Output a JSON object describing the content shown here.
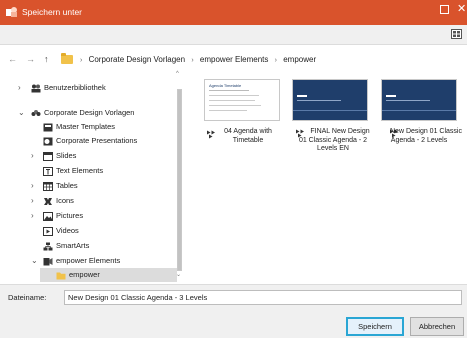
{
  "window": {
    "title": "Speichern unter",
    "title_bar_color": "#d9532c"
  },
  "nav": {
    "breadcrumbs": [
      "Corporate Design Vorlagen",
      "empower Elements",
      "empower"
    ]
  },
  "tree": {
    "items": [
      {
        "label": "Benutzerbibliothek",
        "icon": "library-icon",
        "expander": "collapsed"
      },
      {
        "label": "Corporate Design Vorlagen",
        "icon": "corporate-library-icon",
        "expander": "expanded"
      },
      {
        "label": "Master Templates",
        "icon": "master-templates-icon",
        "expander": "none"
      },
      {
        "label": "Corporate Presentations",
        "icon": "presentation-icon",
        "expander": "none"
      },
      {
        "label": "Slides",
        "icon": "slides-icon",
        "expander": "collapsed"
      },
      {
        "label": "Text Elements",
        "icon": "text-elements-icon",
        "expander": "none"
      },
      {
        "label": "Tables",
        "icon": "table-icon",
        "expander": "collapsed"
      },
      {
        "label": "Icons",
        "icon": "icons-icon",
        "expander": "collapsed"
      },
      {
        "label": "Pictures",
        "icon": "picture-icon",
        "expander": "collapsed"
      },
      {
        "label": "Videos",
        "icon": "video-icon",
        "expander": "none"
      },
      {
        "label": "SmartArts",
        "icon": "smartart-icon",
        "expander": "none"
      },
      {
        "label": "empower Elements",
        "icon": "empower-elements-icon",
        "expander": "expanded"
      },
      {
        "label": "empower",
        "icon": "folder-icon",
        "expander": "none",
        "selected": true
      }
    ]
  },
  "files": [
    {
      "name": "04 Agenda with Timetable",
      "thumb_title": "Agenda Timetable",
      "theme": "white"
    },
    {
      "name": "FINAL New Design 01 Classic Agenda - 2 Levels EN",
      "thumb_title": "",
      "theme": "blue"
    },
    {
      "name": "New Design 01 Classic Agenda - 2 Levels",
      "thumb_title": "",
      "theme": "blue"
    }
  ],
  "filename": {
    "label": "Dateiname:",
    "value": "New Design 01 Classic Agenda - 3 Levels"
  },
  "buttons": {
    "save": "Speichern",
    "cancel": "Abbrechen"
  },
  "colors": {
    "accent": "#2aa6d4",
    "selection": "#dcdcdc",
    "thumb_blue": "#1f3e6b"
  }
}
